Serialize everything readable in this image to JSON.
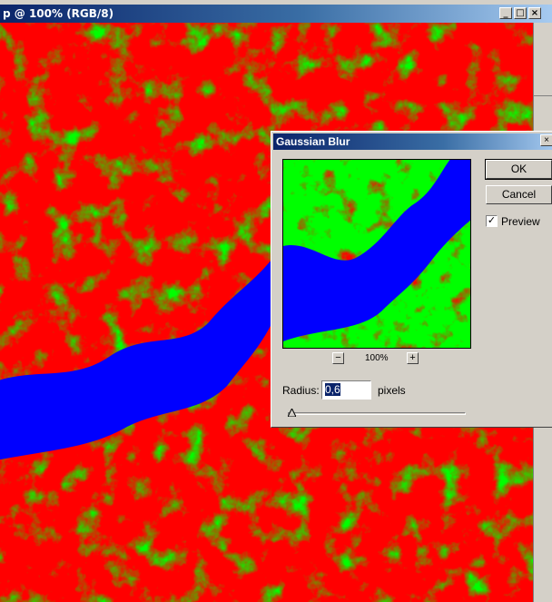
{
  "document": {
    "title": "p @ 100% (RGB/8)",
    "minimize": "_",
    "maximize": "□",
    "close": "×"
  },
  "dialog": {
    "title": "Gaussian Blur",
    "close": "×",
    "ok_label": "OK",
    "cancel_label": "Cancel",
    "preview_label": "Preview",
    "preview_checked": true,
    "zoom_out": "−",
    "zoom_in": "+",
    "zoom_level": "100%",
    "radius_label": "Radius:",
    "radius_value": "0,6",
    "radius_unit": "pixels"
  },
  "colors": {
    "red_region": "#ff0000",
    "green_region": "#00ff00",
    "river_blue": "#0000ff",
    "titlebar": "#0a246a",
    "dialog_face": "#d4d0c8"
  }
}
